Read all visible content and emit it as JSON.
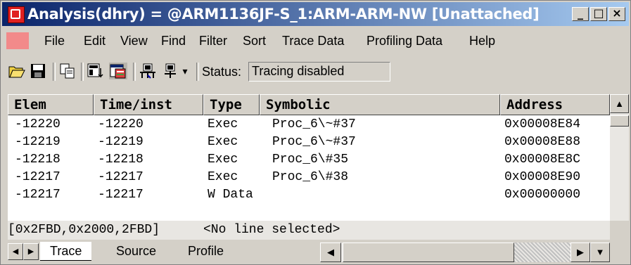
{
  "window": {
    "title": "Analysis(dhry) = @ARM1136JF-S_1:ARM-ARM-NW [Unattached]",
    "minimize": "_",
    "maximize": "□",
    "close": "×"
  },
  "menu": {
    "items": [
      {
        "label": "File"
      },
      {
        "label": "Edit"
      },
      {
        "label": "View"
      },
      {
        "label": "Find"
      },
      {
        "label": "Filter"
      },
      {
        "label": "Sort"
      },
      {
        "label": "Trace Data"
      },
      {
        "label": "Profiling Data"
      },
      {
        "label": "Help"
      }
    ]
  },
  "toolbar": {
    "status_label": "Status:",
    "status_value": "Tracing disabled",
    "dropdown_arrow": "▾"
  },
  "table": {
    "columns": [
      "Elem",
      "Time/inst",
      "Type",
      "Symbolic",
      "Address"
    ],
    "rows": [
      {
        "elem": "-12220",
        "time": "-12220",
        "type": "Exec",
        "symbolic": "Proc_6\\~#37",
        "address": "0x00008E84"
      },
      {
        "elem": "-12219",
        "time": "-12219",
        "type": "Exec",
        "symbolic": "Proc_6\\~#37",
        "address": "0x00008E88"
      },
      {
        "elem": "-12218",
        "time": "-12218",
        "type": "Exec",
        "symbolic": "Proc_6\\#35",
        "address": "0x00008E8C"
      },
      {
        "elem": "-12217",
        "time": "-12217",
        "type": "Exec",
        "symbolic": "Proc_6\\#38",
        "address": "0x00008E90"
      },
      {
        "elem": "-12217",
        "time": "-12217",
        "type": "W Data",
        "symbolic": "",
        "address": "0x00000000"
      }
    ]
  },
  "status_line": {
    "position": "[0x2FBD,0x2000,2FBD]",
    "selection": "<No line selected>"
  },
  "tabs": [
    {
      "label": "Trace"
    },
    {
      "label": "Source"
    },
    {
      "label": "Profile"
    }
  ],
  "scroll": {
    "up": "▲",
    "down": "▼",
    "left": "◀",
    "right": "▶"
  }
}
